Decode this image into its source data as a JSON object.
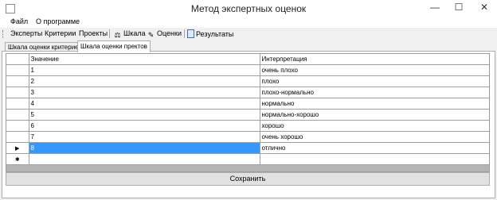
{
  "window": {
    "title": "Метод экспертных оценок",
    "minimize": "—",
    "maximize": "☐",
    "close": "✕"
  },
  "menu": {
    "items": [
      {
        "label": "Файл"
      },
      {
        "label": "О программе"
      }
    ]
  },
  "toolbar": {
    "items": [
      {
        "label": "Эксперты",
        "icon": ""
      },
      {
        "label": "Критерии",
        "icon": ""
      },
      {
        "label": "Проекты",
        "icon": ""
      },
      {
        "label": "Шкала",
        "icon": "scale-icon"
      },
      {
        "label": "Оценки",
        "icon": "assessment-icon"
      },
      {
        "label": "Результаты",
        "icon": "results-icon"
      }
    ]
  },
  "tabs": [
    {
      "label": "Шкала оценки критериев",
      "active": false
    },
    {
      "label": "Шкала оценки пректов",
      "active": true
    }
  ],
  "grid": {
    "columns": [
      "Значение",
      "Интерпретация"
    ],
    "rows": [
      {
        "value": "1",
        "interpretation": "очень плохо"
      },
      {
        "value": "2",
        "interpretation": "плохо"
      },
      {
        "value": "3",
        "interpretation": "плохо-нормально"
      },
      {
        "value": "4",
        "interpretation": "нормально"
      },
      {
        "value": "5",
        "interpretation": "нормально-хорошо"
      },
      {
        "value": "6",
        "interpretation": "хорошо"
      },
      {
        "value": "7",
        "interpretation": "очень хорошо"
      },
      {
        "value": "8",
        "interpretation": "отлично"
      }
    ],
    "selected_row_marker": "▶",
    "new_row_marker": "✱",
    "selection_color": "#3399ff"
  },
  "buttons": {
    "save": "Сохранить"
  }
}
